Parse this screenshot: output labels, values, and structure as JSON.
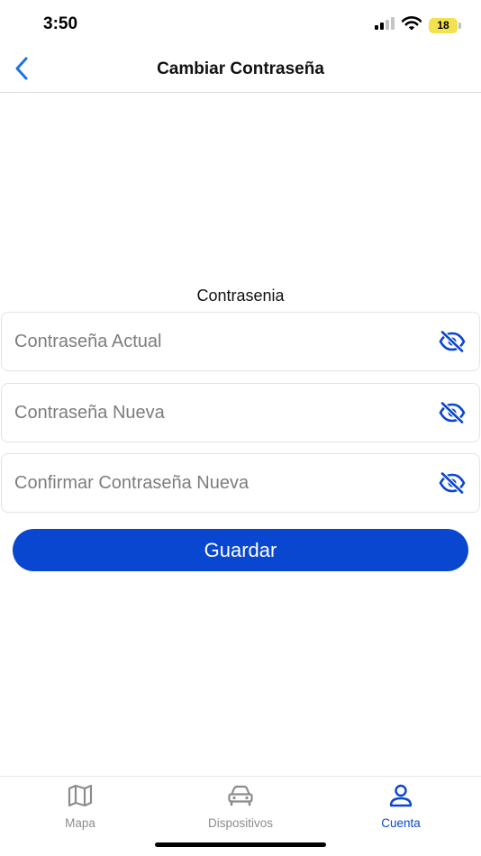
{
  "status_bar": {
    "time": "3:50",
    "battery_level": "18",
    "battery_color": "#f3e24f"
  },
  "nav": {
    "title": "Cambiar Contraseña",
    "back_icon": "chevron-left-icon"
  },
  "form": {
    "section_label": "Contrasenia",
    "fields": [
      {
        "placeholder": "Contraseña Actual",
        "value": "",
        "toggle_icon": "eye-slash-icon"
      },
      {
        "placeholder": "Contraseña Nueva",
        "value": "",
        "toggle_icon": "eye-slash-icon"
      },
      {
        "placeholder": "Confirmar Contraseña Nueva",
        "value": "",
        "toggle_icon": "eye-slash-icon"
      }
    ],
    "save_label": "Guardar"
  },
  "tabs": [
    {
      "label": "Mapa",
      "icon": "map-icon",
      "active": false
    },
    {
      "label": "Dispositivos",
      "icon": "car-icon",
      "active": false
    },
    {
      "label": "Cuenta",
      "icon": "user-icon",
      "active": true
    }
  ],
  "colors": {
    "accent": "#0a47d1",
    "back_chevron": "#1a73e8",
    "inactive_tab": "#8c8c8c",
    "field_border": "#e3e3e3"
  }
}
